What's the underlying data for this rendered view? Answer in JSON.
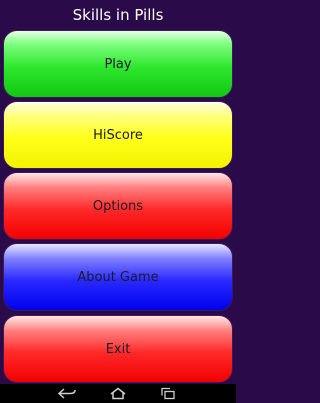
{
  "app": {
    "title": "Skills in Pills"
  },
  "menu": {
    "items": [
      {
        "label": "Play"
      },
      {
        "label": "HiScore"
      },
      {
        "label": "Options"
      },
      {
        "label": "About Game"
      },
      {
        "label": "Exit"
      }
    ]
  },
  "colors": {
    "background": "#2b0a4a",
    "play": "#2ee62e",
    "hiscore": "#ffff1a",
    "options": "#ff2a2a",
    "about": "#2a2aff",
    "exit": "#ff2a2a"
  },
  "navbar": {
    "icons": [
      "back-icon",
      "home-icon",
      "recents-icon"
    ]
  }
}
